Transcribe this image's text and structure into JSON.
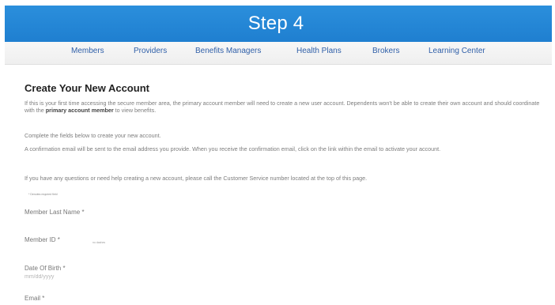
{
  "banner": {
    "title": "Step 4"
  },
  "nav": {
    "items": [
      {
        "label": "Members"
      },
      {
        "label": "Providers"
      },
      {
        "label": "Benefits Managers"
      },
      {
        "label": "Health Plans"
      },
      {
        "label": "Brokers"
      },
      {
        "label": "Learning Center"
      }
    ]
  },
  "page_title": "Create Your New Account",
  "instructions": {
    "p1_prefix": "If this is your first time accessing the secure member area, the primary account member will need to create a new user account. Dependents won't be able to create their own account and should coordinate with the",
    "p1_bold": "primary account member",
    "p1_suffix": "to view benefits.",
    "p2": "Complete the fields below to create your new account.",
    "p3": "A confirmation email will be sent to the email address you provide. When you receive the confirmation email, click on the link within the email to activate your account.",
    "p4": "If you have any questions or need help creating a new account, please call the Customer Service number located at the top of this page."
  },
  "required_note": "* Denotes required field",
  "form": {
    "last_name": {
      "label": "Member Last Name",
      "required_mark": "*"
    },
    "member_id": {
      "label": "Member ID",
      "required_mark": "*",
      "hint": "no dashes"
    },
    "dob": {
      "label": "Date Of Birth",
      "required_mark": "*",
      "placeholder": "mm/dd/yyyy"
    },
    "email": {
      "label": "Email",
      "required_mark": "*"
    }
  }
}
